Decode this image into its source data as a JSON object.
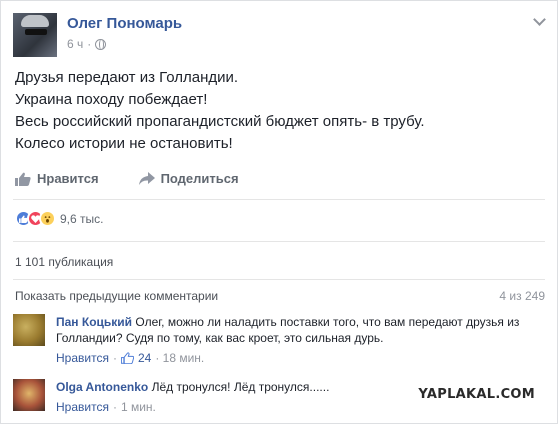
{
  "post": {
    "author": "Олег Пономарь",
    "time": "6 ч",
    "separator": "·",
    "lines": [
      "Друзья передают из Голландии.",
      "Украина походу побеждает!",
      "Весь российский пропагандистский бюджет опять- в трубу.",
      "Колесо истории не остановить!"
    ]
  },
  "actions": {
    "like_label": "Нравится",
    "share_label": "Поделиться"
  },
  "reactions": {
    "count": "9,6 тыс."
  },
  "shares": "1 101 публикация",
  "comments_header": {
    "prev_label": "Показать предыдущие комментарии",
    "pager": "4 из 249"
  },
  "comments": [
    {
      "name": "Пан Коцький",
      "text": " Олег, можно ли наладить поставки того, что вам передают друзья из Голландии? Судя по тому, как вас кроет, это сильная дурь.",
      "like_label": "Нравится",
      "sep": "·",
      "likes": "24",
      "time": "· 18 мин."
    },
    {
      "name": "Olga Antonenko",
      "text": " Лёд тронулся! Лёд тронулся......",
      "like_label": "Нравится",
      "sep": "·",
      "time": "1 мин."
    }
  ],
  "watermark": "YAPLAKAL.COM",
  "colors": {
    "link": "#365899",
    "like_reaction": "#4e7dd8",
    "love_reaction": "#f0445c",
    "wow_reaction": "#fcd05b"
  }
}
